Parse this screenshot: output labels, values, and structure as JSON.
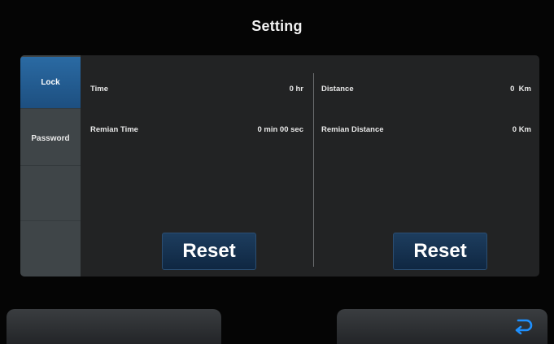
{
  "header": {
    "title": "Setting"
  },
  "tabs": [
    {
      "label": "Lock",
      "active": true
    },
    {
      "label": "Password",
      "active": false
    },
    {
      "label": "",
      "active": false
    },
    {
      "label": "",
      "active": false
    }
  ],
  "left": {
    "time_label": "Time",
    "time_value": "0 hr",
    "remain_label": "Remian Time",
    "remain_value": "0 min 00 sec",
    "reset_label": "Reset"
  },
  "right": {
    "distance_label": "Distance",
    "distance_value": "0  Km",
    "remain_label": "Remian Distance",
    "remain_value": "0 Km",
    "reset_label": "Reset"
  },
  "footer": {
    "back_icon": "back-arrow-icon",
    "accent_color": "#1e90ff"
  }
}
